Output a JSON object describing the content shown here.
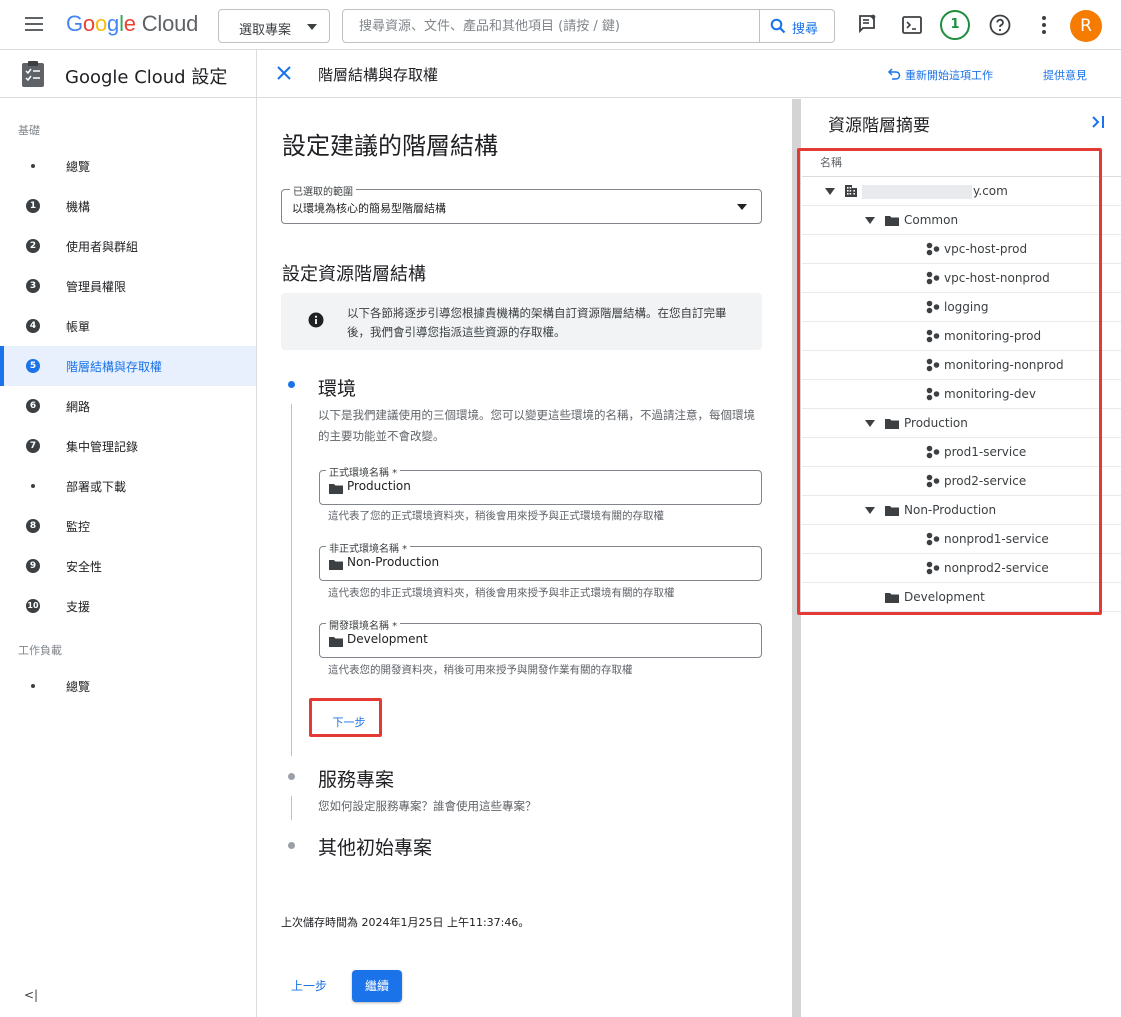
{
  "topbar": {
    "logo_google": "Google",
    "logo_cloud": "Cloud",
    "project_button": "選取專案",
    "search_placeholder": "搜尋資源、文件、產品和其他項目 (請按 / 鍵)",
    "search_button": "搜尋",
    "notification_count": "1",
    "avatar_letter": "R"
  },
  "sidebar": {
    "title": "Google Cloud 設定",
    "section_basics": "基礎",
    "items": [
      {
        "marker": "dot",
        "label": "總覽"
      },
      {
        "marker": "1",
        "label": "機構"
      },
      {
        "marker": "2",
        "label": "使用者與群組"
      },
      {
        "marker": "3",
        "label": "管理員權限"
      },
      {
        "marker": "4",
        "label": "帳單"
      },
      {
        "marker": "5",
        "label": "階層結構與存取權",
        "active": true
      },
      {
        "marker": "6",
        "label": "網路"
      },
      {
        "marker": "7",
        "label": "集中管理記錄"
      },
      {
        "marker": "dot",
        "label": "部署或下載"
      },
      {
        "marker": "8",
        "label": "監控"
      },
      {
        "marker": "9",
        "label": "安全性"
      },
      {
        "marker": "10",
        "label": "支援"
      }
    ],
    "section_workloads": "工作負載",
    "workload_items": [
      {
        "marker": "dot",
        "label": "總覽"
      }
    ],
    "collapse_label": "<|"
  },
  "content_header": {
    "title": "階層結構與存取權",
    "restart_label": "重新開始這項工作",
    "feedback_label": "提供意見"
  },
  "main": {
    "heading": "設定建議的階層結構",
    "scope_select": {
      "legend": "已選取的範圍",
      "value": "以環境為核心的簡易型階層結構"
    },
    "section_heading": "設定資源階層結構",
    "info_text": "以下各節將逐步引導您根據貴機構的架構自訂資源階層結構。在您自訂完畢後，我們會引導您指派這些資源的存取權。",
    "steps": {
      "env": {
        "title": "環境",
        "desc": "以下是我們建議使用的三個環境。您可以變更這些環境的名稱，不過請注意，每個環境的主要功能並不會改變。",
        "fields": [
          {
            "legend": "正式環境名稱 *",
            "value": "Production",
            "help": "這代表了您的正式環境資料夾，稍後會用來授予與正式環境有關的存取權"
          },
          {
            "legend": "非正式環境名稱 *",
            "value": "Non-Production",
            "help": "這代表您的非正式環境資料夾，稍後會用來授予與非正式環境有關的存取權"
          },
          {
            "legend": "開發環境名稱 *",
            "value": "Development",
            "help": "這代表您的開發資料夾，稍後可用來授予與開發作業有關的存取權"
          }
        ],
        "next_button": "下一步"
      },
      "service": {
        "title": "服務專案",
        "desc": "您如何設定服務專案？誰會使用這些專案？"
      },
      "other": {
        "title": "其他初始專案"
      }
    },
    "saved_text": "上次儲存時間為 2024年1月25日 上午11:37:46。",
    "prev_button": "上一步",
    "continue_button": "繼續"
  },
  "right_panel": {
    "title": "資源階層摘要",
    "column_header": "名稱",
    "tree": [
      {
        "level": 0,
        "type": "org",
        "label": "y.com",
        "expanded": true,
        "redacted_prefix": true
      },
      {
        "level": 1,
        "type": "folder",
        "label": "Common",
        "expanded": true
      },
      {
        "level": 2,
        "type": "project",
        "label": "vpc-host-prod"
      },
      {
        "level": 2,
        "type": "project",
        "label": "vpc-host-nonprod"
      },
      {
        "level": 2,
        "type": "project",
        "label": "logging"
      },
      {
        "level": 2,
        "type": "project",
        "label": "monitoring-prod"
      },
      {
        "level": 2,
        "type": "project",
        "label": "monitoring-nonprod"
      },
      {
        "level": 2,
        "type": "project",
        "label": "monitoring-dev"
      },
      {
        "level": 1,
        "type": "folder",
        "label": "Production",
        "expanded": true
      },
      {
        "level": 2,
        "type": "project",
        "label": "prod1-service"
      },
      {
        "level": 2,
        "type": "project",
        "label": "prod2-service"
      },
      {
        "level": 1,
        "type": "folder",
        "label": "Non-Production",
        "expanded": true
      },
      {
        "level": 2,
        "type": "project",
        "label": "nonprod1-service"
      },
      {
        "level": 2,
        "type": "project",
        "label": "nonprod2-service"
      },
      {
        "level": 1,
        "type": "folder",
        "label": "Development",
        "expanded": false
      }
    ]
  },
  "colors": {
    "accent": "#1a73e8",
    "highlight": "#e53935",
    "avatar": "#f57c00",
    "badge": "#1e8e3e"
  }
}
